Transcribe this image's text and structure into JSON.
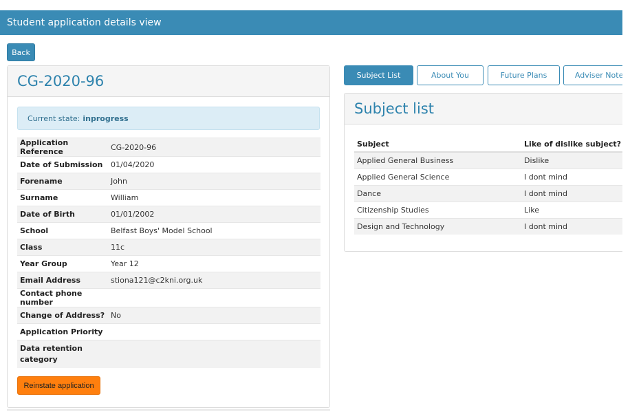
{
  "header": {
    "title": "Student application details view"
  },
  "back_label": "Back",
  "application": {
    "id": "CG-2020-96",
    "state_label": "Current state:",
    "state_value": "inprogress",
    "fields": [
      {
        "label": "Application Reference",
        "value": "CG-2020-96"
      },
      {
        "label": "Date of Submission",
        "value": "01/04/2020"
      },
      {
        "label": "Forename",
        "value": "John"
      },
      {
        "label": "Surname",
        "value": "William"
      },
      {
        "label": "Date of Birth",
        "value": "01/01/2002"
      },
      {
        "label": "School",
        "value": "Belfast Boys' Model School"
      },
      {
        "label": "Class",
        "value": "11c"
      },
      {
        "label": "Year Group",
        "value": "Year 12"
      },
      {
        "label": "Email Address",
        "value": "stiona121@c2kni.org.uk"
      },
      {
        "label": "Contact phone number",
        "value": ""
      },
      {
        "label": "Change of Address?",
        "value": "No"
      },
      {
        "label": "Application Priority",
        "value": ""
      },
      {
        "label": "Data retention category",
        "value": ""
      }
    ],
    "reinstate_label": "Reinstate application"
  },
  "tabs": [
    {
      "label": "Subject List",
      "active": true
    },
    {
      "label": "About You",
      "active": false
    },
    {
      "label": "Future Plans",
      "active": false
    },
    {
      "label": "Adviser Notes",
      "active": false
    }
  ],
  "subject_list": {
    "title": "Subject list",
    "columns": [
      "Subject",
      "Like of dislike subject?"
    ],
    "rows": [
      [
        "Applied General Business",
        "Dislike"
      ],
      [
        "Applied General Science",
        "I dont mind"
      ],
      [
        "Dance",
        "I dont mind"
      ],
      [
        "Citizenship Studies",
        "Like"
      ],
      [
        "Design and Technology",
        "I dont mind"
      ]
    ]
  },
  "colors": {
    "primary": "#3a8bb5",
    "accent": "#ff7f0e",
    "info_bg": "#dcedf6"
  }
}
